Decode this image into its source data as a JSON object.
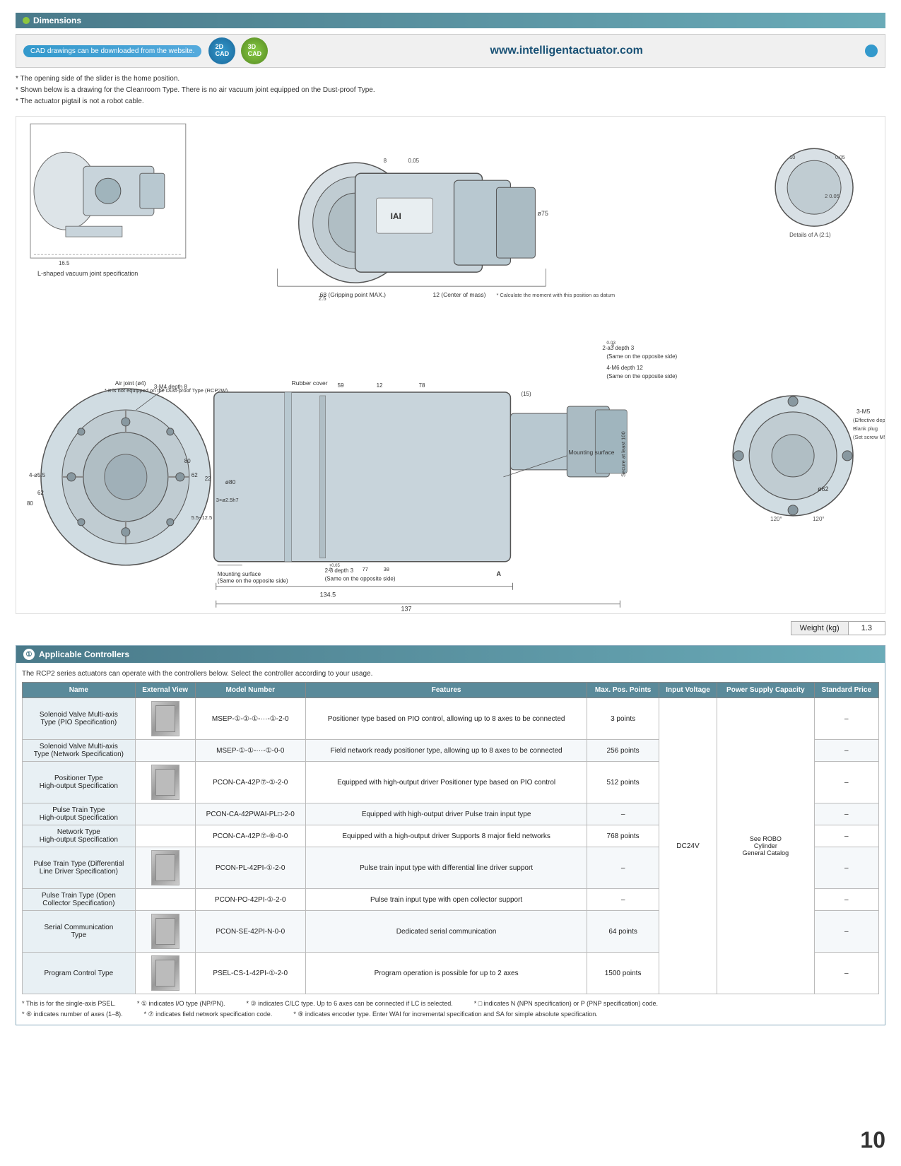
{
  "page": {
    "number": "10"
  },
  "dimensions_section": {
    "title": "Dimensions",
    "cad_text": "CAD drawings can be downloaded from the website.",
    "cad_url": "www.intelligentactuator.com",
    "cad_2d_label": "2D\nCAD",
    "cad_3d_label": "3D\nCAD",
    "notes": [
      "* The opening side of the slider is the home position.",
      "* Shown below is a drawing for the Cleanroom Type. There is no air vacuum joint equipped on the Dust-proof Type.",
      "* The actuator pigtail is not a robot cable."
    ],
    "weight_label": "Weight (kg)",
    "weight_value": "1.3",
    "l_shaped_label": "L-shaped vacuum joint specification"
  },
  "controllers_section": {
    "title": "Applicable Controllers",
    "circle_num": "①",
    "sub_note": "The RCP2 series actuators can operate with the controllers below. Select the controller according to your usage.",
    "table_headers": [
      "Name",
      "External View",
      "Model Number",
      "Features",
      "Max. Pos. Points",
      "Input Voltage",
      "Power Supply Capacity",
      "Standard Price"
    ],
    "rows": [
      {
        "name": "Solenoid Valve Multi-axis\nType (PIO Specification)",
        "model": "MSEP-①-①-①-···-①-2-0",
        "features": "Positioner type based on PIO control, allowing up to 8 axes to be connected",
        "max_pos": "3 points",
        "has_img": true
      },
      {
        "name": "Solenoid Valve Multi-axis\nType (Network Specification)",
        "model": "MSEP-①-①-···-①-0-0",
        "features": "Field network ready positioner type, allowing up to 8 axes to be connected",
        "max_pos": "256 points",
        "has_img": false
      },
      {
        "name": "Positioner Type\nHigh-output Specification",
        "model": "PCON-CA-42P⑦-①-2-0",
        "features": "Equipped with high-output driver Positioner type based on PIO control",
        "max_pos": "512 points",
        "has_img": true
      },
      {
        "name": "Pulse Train Type\nHigh-output Specification",
        "model": "PCON-CA-42PWAI-PL□-2-0",
        "features": "Equipped with high-output driver Pulse train input type",
        "max_pos": "–",
        "has_img": false
      },
      {
        "name": "Network Type\nHigh-output Specification",
        "model": "PCON-CA-42P⑦-⑥-0-0",
        "features": "Equipped with a high-output driver Supports 8 major field networks",
        "max_pos": "768 points",
        "has_img": false
      },
      {
        "name": "Pulse Train Type (Differential\nLine Driver Specification)",
        "model": "PCON-PL-42PI-①-2-0",
        "features": "Pulse train input type with differential line driver support",
        "max_pos": "–",
        "has_img": true
      },
      {
        "name": "Pulse Train Type (Open\nCollector Specification)",
        "model": "PCON-PO-42PI-①-2-0",
        "features": "Pulse train input type with open collector support",
        "max_pos": "–",
        "has_img": false
      },
      {
        "name": "Serial Communication\nType",
        "model": "PCON-SE-42PI-N-0-0",
        "features": "Dedicated serial communication",
        "max_pos": "64 points",
        "has_img": true
      },
      {
        "name": "Program Control Type",
        "model": "PSEL-CS-1-42PI-①-2-0",
        "features": "Program operation is possible for up to 2 axes",
        "max_pos": "1500 points",
        "has_img": true
      }
    ],
    "input_voltage": "DC24V",
    "power_supply": "See ROBO\nCylinder\nGeneral Catalog",
    "standard_price": "–",
    "footnotes": [
      "* This is for the single-axis PSEL.",
      "* ① indicates I/O type (NP/PN).",
      "* ⑥ indicates number of axes (1–8).",
      "* ⑦ indicates field network specification code.",
      "* ③ indicates C/LC type. Up to 6 axes can be connected if LC is selected.",
      "* ⑧ indicates encoder type. Enter WAI for incremental specification and SA for simple absolute specification.",
      "* □ indicates N (NPN specification) or P (PNP specification) code."
    ]
  }
}
